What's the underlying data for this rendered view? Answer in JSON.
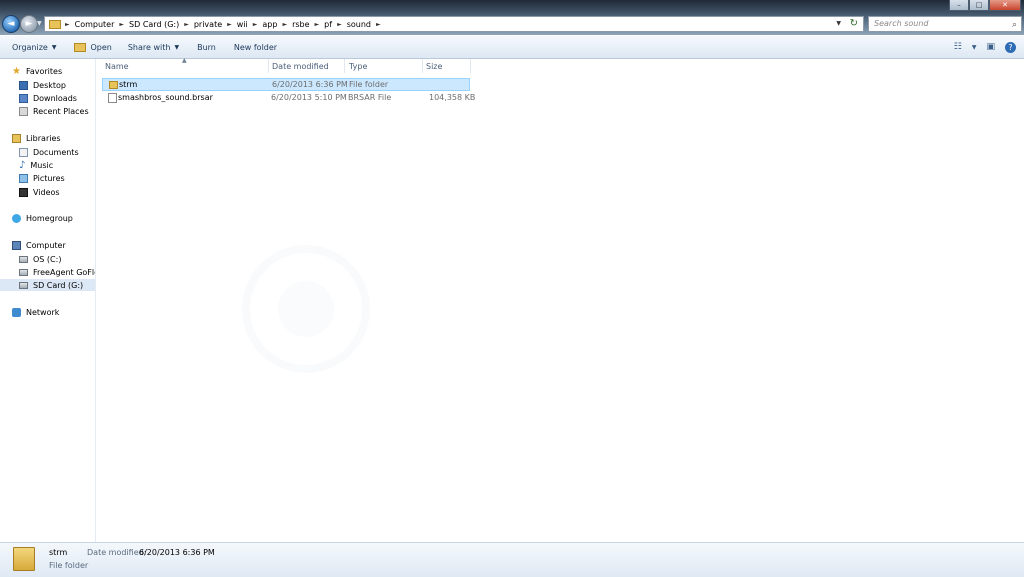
{
  "window": {
    "controls": {
      "minimize": "–",
      "maximize": "□",
      "close": "✕"
    }
  },
  "address_bar": {
    "back_icon": "back-arrow-icon",
    "forward_icon": "forward-arrow-icon",
    "breadcrumbs": [
      "Computer",
      "SD Card (G:)",
      "private",
      "wii",
      "app",
      "rsbe",
      "pf",
      "sound"
    ],
    "refresh_icon": "refresh-icon"
  },
  "search": {
    "placeholder": "Search sound"
  },
  "command_bar": {
    "organize": "Organize",
    "open": "Open",
    "share_with": "Share with",
    "burn": "Burn",
    "new_folder": "New folder"
  },
  "nav_pane": {
    "favorites": {
      "label": "Favorites",
      "items": [
        "Desktop",
        "Downloads",
        "Recent Places"
      ]
    },
    "libraries": {
      "label": "Libraries",
      "items": [
        "Documents",
        "Music",
        "Pictures",
        "Videos"
      ]
    },
    "homegroup": {
      "label": "Homegroup"
    },
    "computer": {
      "label": "Computer",
      "items": [
        "OS (C:)",
        "FreeAgent GoFlex",
        "SD Card (G:)"
      ],
      "selected": "SD Card (G:)"
    },
    "network": {
      "label": "Network"
    }
  },
  "file_list": {
    "columns": [
      "Name",
      "Date modified",
      "Type",
      "Size"
    ],
    "rows": [
      {
        "name": "strm",
        "date_modified": "6/20/2013 6:36 PM",
        "type": "File folder",
        "size": "",
        "icon": "folder-icon",
        "selected": true
      },
      {
        "name": "smashbros_sound.brsar",
        "date_modified": "6/20/2013 5:10 PM",
        "type": "BRSAR File",
        "size": "104,358 KB",
        "icon": "file-icon",
        "selected": false
      }
    ]
  },
  "details_pane": {
    "name": "strm",
    "type": "File folder",
    "date_modified_label": "Date modified:",
    "date_modified_value": "6/20/2013 6:36 PM"
  },
  "colors": {
    "selection_bg": "#cce8ff",
    "selection_border": "#99d1ff",
    "command_bar_bg": "#dde8f3",
    "accent": "#1e395b"
  }
}
